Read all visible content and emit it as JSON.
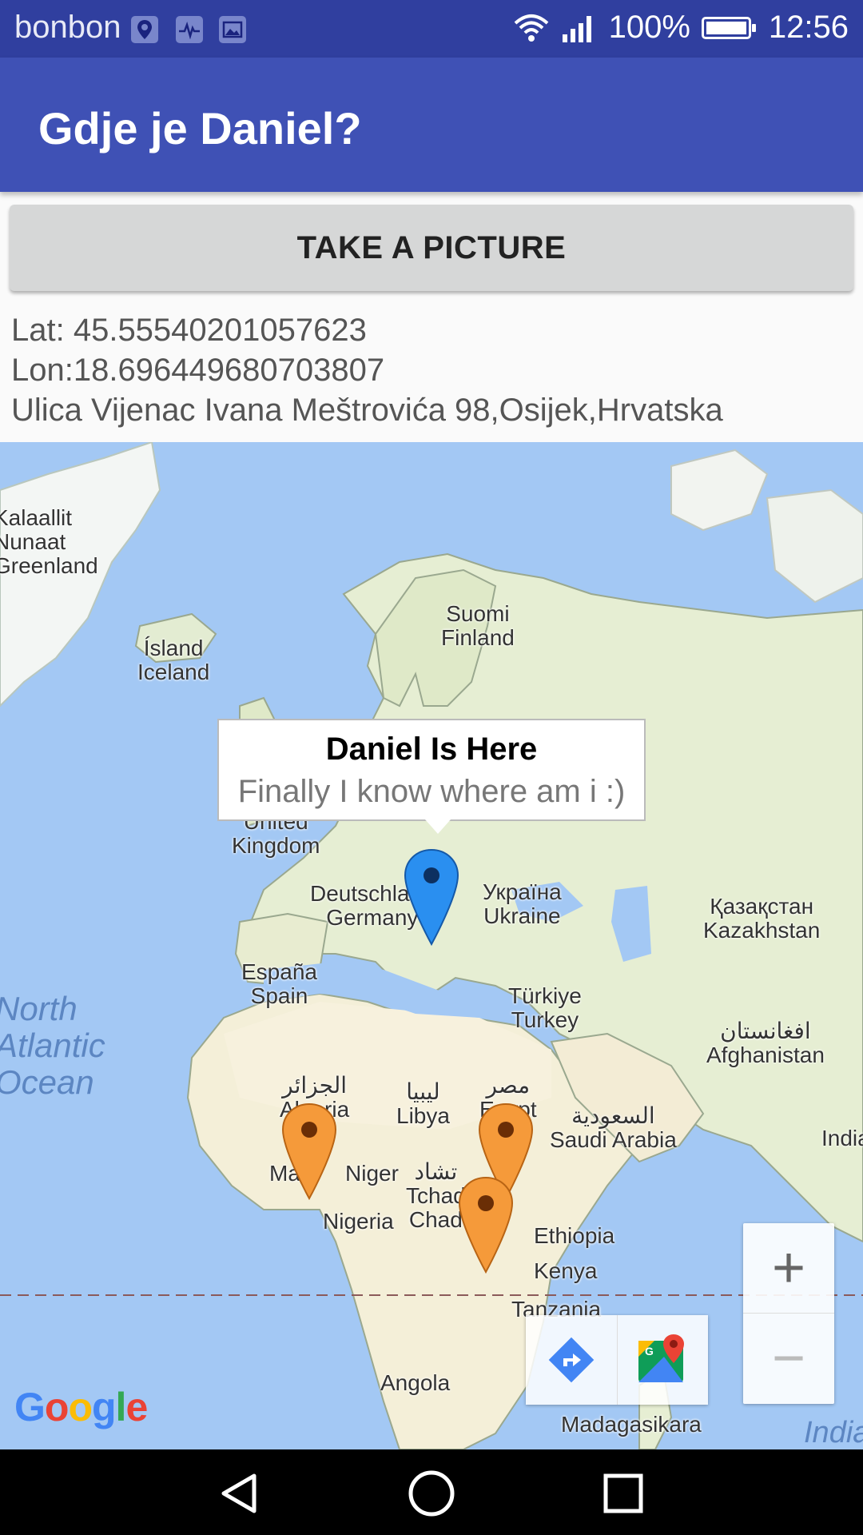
{
  "status_bar": {
    "carrier": "bonbon",
    "battery_text": "100%",
    "battery_level": 1.0,
    "time": "12:56",
    "icons": [
      "location-icon",
      "health-icon",
      "image-icon",
      "wifi-icon",
      "signal-icon",
      "battery-icon"
    ]
  },
  "app_bar": {
    "title": "Gdje je Daniel?"
  },
  "take_picture": {
    "label": "TAKE A PICTURE"
  },
  "location": {
    "lat": "Lat: 45.55540201057623",
    "lon": "Lon:18.696449680703807",
    "address": "Ulica Vijenac Ivana Meštrovića 98,Osijek,Hrvatska"
  },
  "map": {
    "info_window": {
      "title": "Daniel Is Here",
      "snippet": "Finally I know where am i :)"
    },
    "labels": {
      "greenland": "Kalaallit\nNunaat\nGreenland",
      "finland": "Suomi\nFinland",
      "iceland": "Ísland\nIceland",
      "uk": "United\nKingdom",
      "germany": "Deutschland\nGermany",
      "ukraine": "Україна\nUkraine",
      "kazakhstan": "Қазақстан\nKazakhstan",
      "spain": "España\nSpain",
      "turkey": "Türkiye\nTurkey",
      "afghanistan": "افغانستان\nAfghanistan",
      "algeria": "الجزائر\nAlgeria",
      "libya": "ليبيا\nLibya",
      "egypt": "مصر\nEgypt",
      "saudi": "السعودية\nSaudi Arabia",
      "india": "India",
      "mali": "Mali",
      "niger": "Niger",
      "chad": "تشاد\nTchad\nChad",
      "nigeria": "Nigeria",
      "ethiopia": "Ethiopia",
      "kenya": "Kenya",
      "tanzania": "Tanzania",
      "angola": "Angola",
      "madagascar": "Madagasikara",
      "atlantic": "North\nAtlantic\nOcean",
      "indian": "India"
    },
    "zoom_in": "+",
    "zoom_out": "−",
    "logo": "Google",
    "markers": [
      {
        "name": "daniel-marker",
        "color": "#2196f3"
      },
      {
        "name": "mali-marker",
        "color": "#f59a3a"
      },
      {
        "name": "egypt-marker",
        "color": "#f59a3a"
      },
      {
        "name": "central-africa-marker",
        "color": "#f59a3a"
      }
    ]
  },
  "colors": {
    "status_bar": "#303f9f",
    "app_bar": "#3f51b5",
    "water": "#a3c8f4",
    "land": "#e9efd9"
  }
}
